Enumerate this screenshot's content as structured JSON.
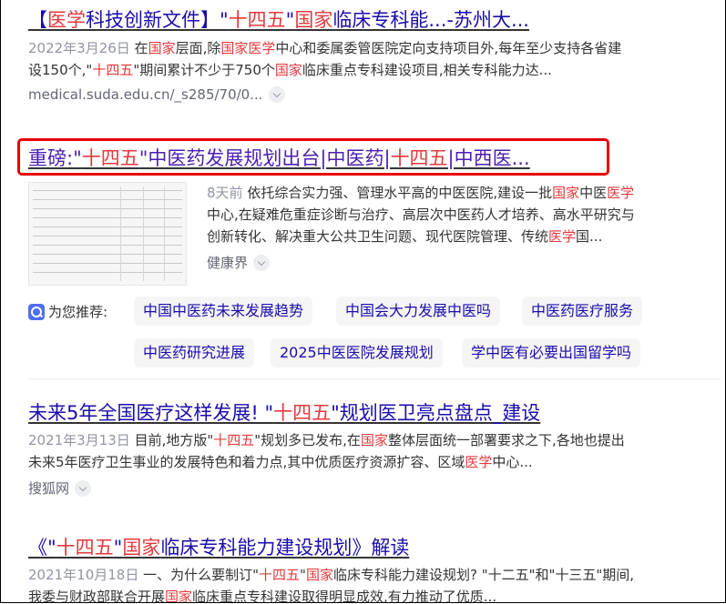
{
  "results": [
    {
      "title_parts": [
        {
          "t": "【"
        },
        {
          "t": "医学",
          "hl": true
        },
        {
          "t": "科技创新文件】\""
        },
        {
          "t": "十四五",
          "hl": true
        },
        {
          "t": "\""
        },
        {
          "t": "国家",
          "hl": true
        },
        {
          "t": "临床专科能...-苏州大..."
        }
      ],
      "snippet_lines": [
        [
          {
            "t": "2022年3月26日 ",
            "date": true
          },
          {
            "t": "在"
          },
          {
            "t": "国家",
            "hl": true
          },
          {
            "t": "层面,除"
          },
          {
            "t": "国家",
            "hl": true
          },
          {
            "t": "医学",
            "hl": true
          },
          {
            "t": "中心和委属委管医院定向支持项目外,每年至少支持各省建"
          }
        ],
        [
          {
            "t": "设150个,\""
          },
          {
            "t": "十四五",
            "hl": true
          },
          {
            "t": "\"期间累计不少于750个"
          },
          {
            "t": "国家",
            "hl": true
          },
          {
            "t": "临床重点专科建设项目,相关专科能力达..."
          }
        ]
      ],
      "source": "medical.suda.edu.cn/_s285/70/0..."
    },
    {
      "title_parts": [
        {
          "t": "重磅:\""
        },
        {
          "t": "十四五",
          "hl": true
        },
        {
          "t": "\"中医药发展规划出台|中医药|"
        },
        {
          "t": "十四五",
          "hl": true
        },
        {
          "t": "|中西医..."
        }
      ],
      "snippet_lines": [
        [
          {
            "t": "8天前 ",
            "date": true
          },
          {
            "t": "依托综合实力强、管理水平高的中医医院,建设一批"
          },
          {
            "t": "国家",
            "hl": true
          },
          {
            "t": "中医"
          },
          {
            "t": "医学",
            "hl": true
          }
        ],
        [
          {
            "t": "中心,在疑难危重症诊断与治疗、高层次中医药人才培养、高水平研究与"
          }
        ],
        [
          {
            "t": "创新转化、解决重大公共卫生问题、现代医院管理、传统"
          },
          {
            "t": "医学",
            "hl": true
          },
          {
            "t": "国..."
          }
        ]
      ],
      "source": "健康界"
    },
    {
      "title_parts": [
        {
          "t": "未来5年全国医疗这样发展! \""
        },
        {
          "t": "十四五",
          "hl": true
        },
        {
          "t": "\"规划医卫亮点盘点_建设"
        }
      ],
      "snippet_lines": [
        [
          {
            "t": "2021年3月13日 ",
            "date": true
          },
          {
            "t": "目前,地方版\""
          },
          {
            "t": "十四五",
            "hl": true
          },
          {
            "t": "\"规划多已发布,在"
          },
          {
            "t": "国家",
            "hl": true
          },
          {
            "t": "整体层面统一部署要求之下,各地也提出"
          }
        ],
        [
          {
            "t": "未来5年医疗卫生事业的发展特色和着力点,其中优质医疗资源扩容、区域"
          },
          {
            "t": "医学",
            "hl": true
          },
          {
            "t": "中心..."
          }
        ]
      ],
      "source": "搜狐网"
    },
    {
      "title_parts": [
        {
          "t": "《\""
        },
        {
          "t": "十四五",
          "hl": true
        },
        {
          "t": "\""
        },
        {
          "t": "国家",
          "hl": true
        },
        {
          "t": "临床专科能力建设规划》解读"
        }
      ],
      "snippet_lines": [
        [
          {
            "t": "2021年10月18日 ",
            "date": true
          },
          {
            "t": "一、为什么要制订\""
          },
          {
            "t": "十四五",
            "hl": true
          },
          {
            "t": "\""
          },
          {
            "t": "国家",
            "hl": true
          },
          {
            "t": "临床专科能力建设规划? \"十二五\"和\"十三五\"期间,"
          }
        ],
        [
          {
            "t": "我委与财政部联合开展"
          },
          {
            "t": "国家",
            "hl": true
          },
          {
            "t": "临床重点专科建设取得明显成效,有力推动了优质..."
          }
        ]
      ],
      "source": ""
    }
  ],
  "recommend": {
    "label": "为您推荐:",
    "tags": [
      "中国中医药未来发展趋势",
      "中国会大力发展中医吗",
      "中医药医疗服务",
      "中医药研究进展",
      "2025中医医院发展规划",
      "学中医有必要出国留学吗"
    ]
  },
  "colors": {
    "link": "#1a0dab",
    "highlight": "#e4393c",
    "date": "#9195a3",
    "box": "#e80000"
  }
}
